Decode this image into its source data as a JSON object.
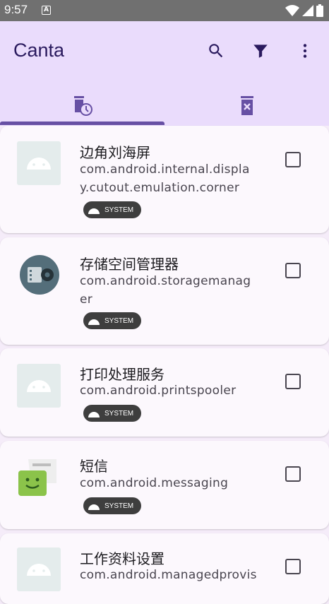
{
  "status_bar": {
    "time": "9:57",
    "notification_letter": "A"
  },
  "app_bar": {
    "title": "Canta"
  },
  "actions": [
    "search-icon",
    "filter-icon",
    "more-vert-icon"
  ],
  "tabs": [
    {
      "icon": "delete-clock-icon",
      "selected": true
    },
    {
      "icon": "delete-x-icon",
      "selected": false
    }
  ],
  "badge_label": "SYSTEM",
  "apps": [
    {
      "name": "边角刘海屏",
      "package": "com.android.internal.display.cutout.emulation.corner",
      "icon": "android-placeholder-icon",
      "system": true
    },
    {
      "name": "存储空间管理器",
      "package": "com.android.storagemanager",
      "icon": "storage-manager-icon",
      "system": true
    },
    {
      "name": "打印处理服务",
      "package": "com.android.printspooler",
      "icon": "android-placeholder-icon",
      "system": true
    },
    {
      "name": "短信",
      "package": "com.android.messaging",
      "icon": "messaging-icon",
      "system": true
    },
    {
      "name": "工作资料设置",
      "package": "com.android.managedprovisi",
      "icon": "android-placeholder-icon",
      "system": false
    }
  ],
  "colors": {
    "app_bar": "#eadcfc",
    "accent": "#6750a4",
    "badge": "#3e3e3e",
    "card": "#fcf8fd"
  }
}
